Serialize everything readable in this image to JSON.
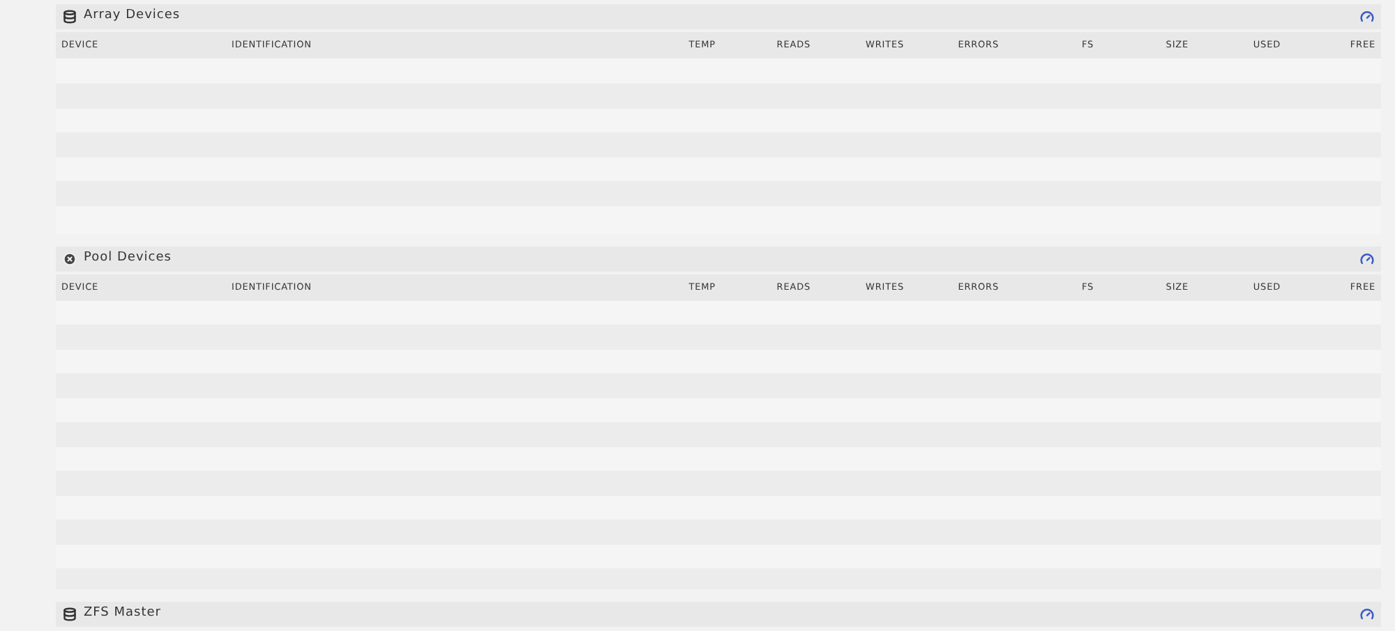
{
  "sections": [
    {
      "title": "Array Devices",
      "kind": "database",
      "columns": [
        "DEVICE",
        "IDENTIFICATION",
        "TEMP",
        "READS",
        "WRITES",
        "ERRORS",
        "FS",
        "SIZE",
        "USED",
        "FREE"
      ]
    },
    {
      "title": "Pool Devices",
      "kind": "pool",
      "columns": [
        "DEVICE",
        "IDENTIFICATION",
        "TEMP",
        "READS",
        "WRITES",
        "ERRORS",
        "FS",
        "SIZE",
        "USED",
        "FREE"
      ]
    },
    {
      "title": "ZFS Master",
      "kind": "database"
    }
  ]
}
